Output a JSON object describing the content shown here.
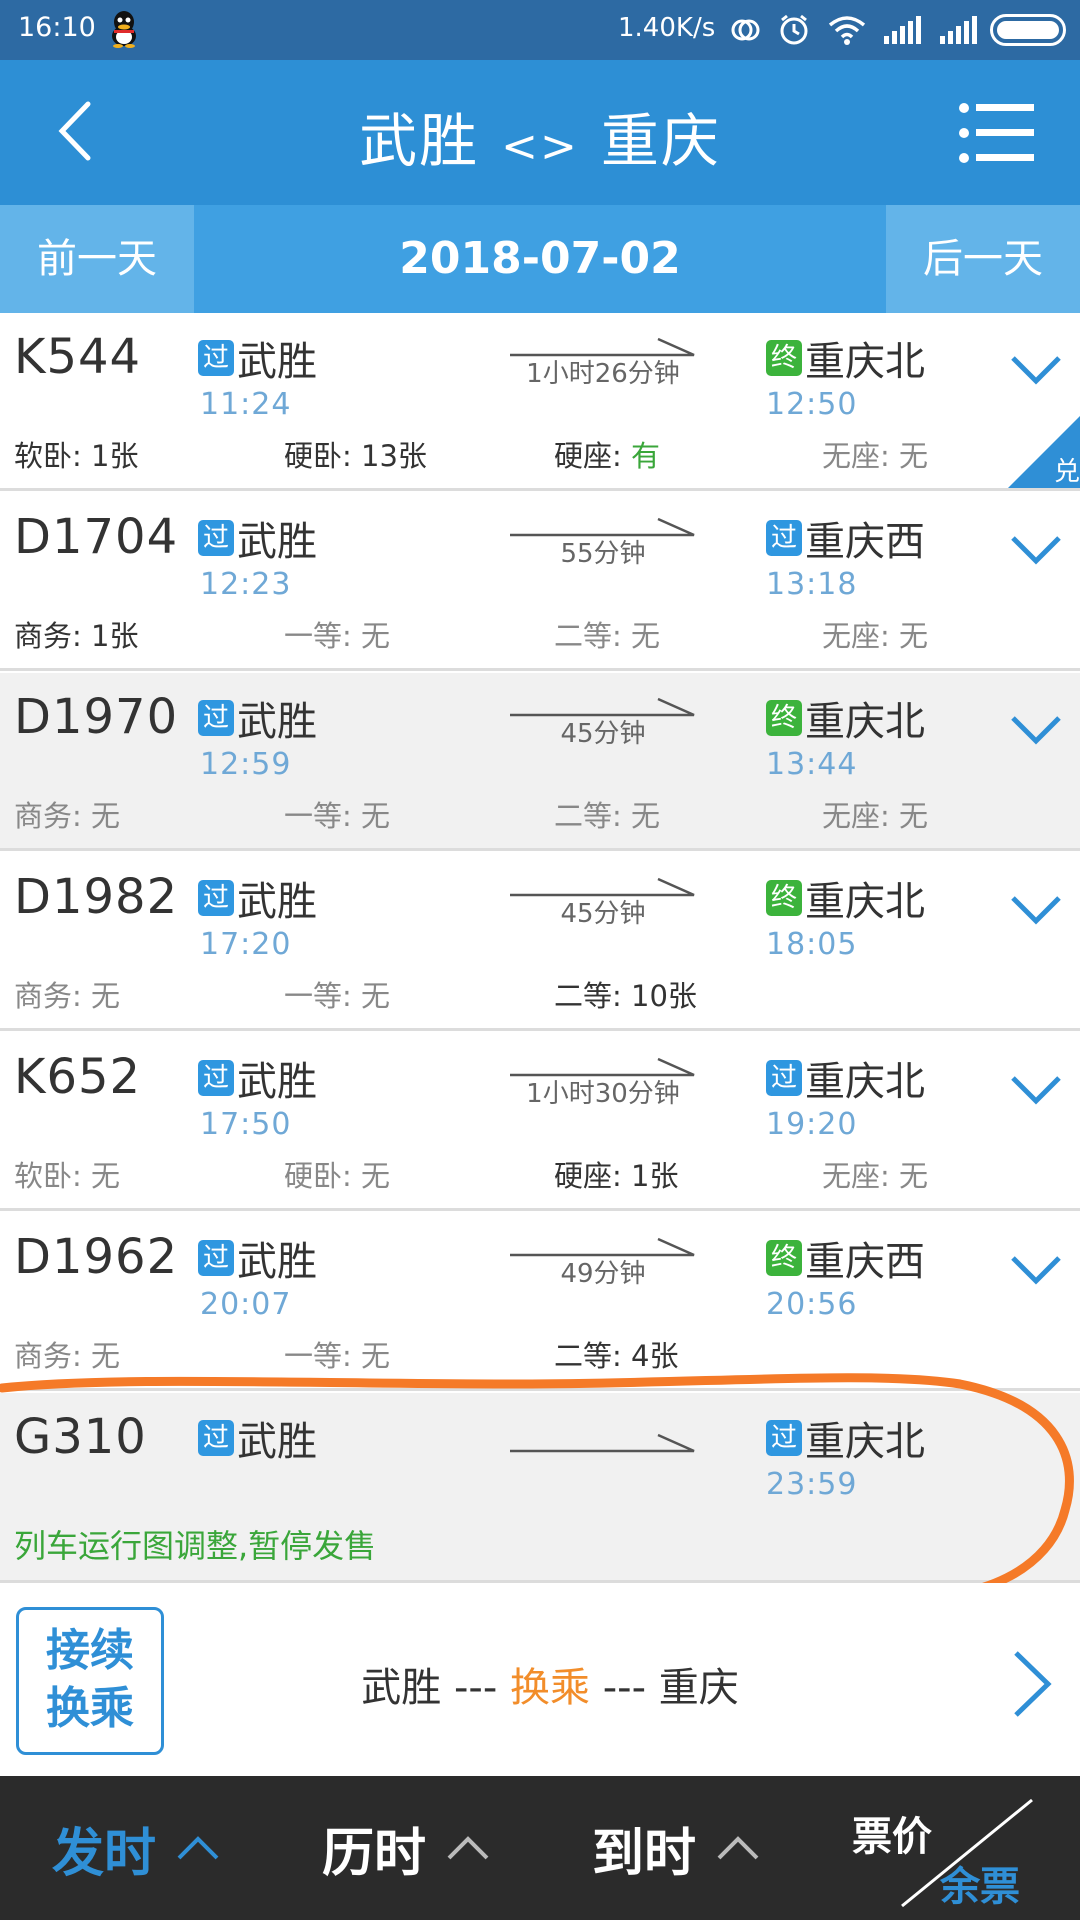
{
  "status_bar": {
    "time": "16:10",
    "net_speed": "1.40K/s",
    "icons": [
      "qq-icon",
      "sync-icon",
      "alarm-icon",
      "wifi-icon",
      "signal-icon",
      "signal-icon",
      "battery-icon"
    ]
  },
  "header": {
    "from": "武胜",
    "separator": "<>",
    "to": "重庆"
  },
  "date_bar": {
    "prev_label": "前一天",
    "date": "2018-07-02",
    "next_label": "后一天"
  },
  "trains": [
    {
      "no": "K544",
      "dep": {
        "badge": "过",
        "station": "武胜",
        "time": "11:24"
      },
      "arr": {
        "badge": "终",
        "station": "重庆北",
        "time": "12:50"
      },
      "duration": "1小时26分钟",
      "seats": [
        {
          "label": "软卧: ",
          "value": "1张"
        },
        {
          "label": "硬卧: ",
          "value": "13张"
        },
        {
          "label": "硬座: ",
          "value": "有"
        },
        {
          "label": "无座: ",
          "value": "无"
        }
      ],
      "corner_badge": "兑"
    },
    {
      "no": "D1704",
      "dep": {
        "badge": "过",
        "station": "武胜",
        "time": "12:23"
      },
      "arr": {
        "badge": "过",
        "station": "重庆西",
        "time": "13:18"
      },
      "duration": "55分钟",
      "seats": [
        {
          "label": "商务: ",
          "value": "1张"
        },
        {
          "label": "一等: ",
          "value": "无"
        },
        {
          "label": "二等: ",
          "value": "无"
        },
        {
          "label": "无座: ",
          "value": "无"
        }
      ]
    },
    {
      "no": "D1970",
      "dep": {
        "badge": "过",
        "station": "武胜",
        "time": "12:59"
      },
      "arr": {
        "badge": "终",
        "station": "重庆北",
        "time": "13:44"
      },
      "duration": "45分钟",
      "seats": [
        {
          "label": "商务: ",
          "value": "无"
        },
        {
          "label": "一等: ",
          "value": "无"
        },
        {
          "label": "二等: ",
          "value": "无"
        },
        {
          "label": "无座: ",
          "value": "无"
        }
      ]
    },
    {
      "no": "D1982",
      "dep": {
        "badge": "过",
        "station": "武胜",
        "time": "17:20"
      },
      "arr": {
        "badge": "终",
        "station": "重庆北",
        "time": "18:05"
      },
      "duration": "45分钟",
      "seats": [
        {
          "label": "商务: ",
          "value": "无"
        },
        {
          "label": "一等: ",
          "value": "无"
        },
        {
          "label": "二等: ",
          "value": "10张"
        }
      ]
    },
    {
      "no": "K652",
      "dep": {
        "badge": "过",
        "station": "武胜",
        "time": "17:50"
      },
      "arr": {
        "badge": "过",
        "station": "重庆北",
        "time": "19:20"
      },
      "duration": "1小时30分钟",
      "seats": [
        {
          "label": "软卧: ",
          "value": "无"
        },
        {
          "label": "硬卧: ",
          "value": "无"
        },
        {
          "label": "硬座: ",
          "value": "1张"
        },
        {
          "label": "无座: ",
          "value": "无"
        }
      ]
    },
    {
      "no": "D1962",
      "dep": {
        "badge": "过",
        "station": "武胜",
        "time": "20:07"
      },
      "arr": {
        "badge": "终",
        "station": "重庆西",
        "time": "20:56"
      },
      "duration": "49分钟",
      "seats": [
        {
          "label": "商务: ",
          "value": "无"
        },
        {
          "label": "一等: ",
          "value": "无"
        },
        {
          "label": "二等: ",
          "value": "4张"
        }
      ]
    },
    {
      "no": "G310",
      "dep": {
        "badge": "过",
        "station": "武胜",
        "time": ""
      },
      "arr": {
        "badge": "过",
        "station": "重庆北",
        "time": "23:59"
      },
      "duration": "",
      "notice": "列车运行图调整,暂停发售"
    }
  ],
  "transfer": {
    "button_line1": "接续",
    "button_line2": "换乘",
    "from": "武胜",
    "dash1": " --- ",
    "middle": "换乘",
    "dash2": " --- ",
    "to": "重庆"
  },
  "sort_bar": {
    "depart": "发时",
    "duration": "历时",
    "arrive": "到时",
    "price": "票价",
    "tickets": "余票"
  },
  "colors": {
    "header_blue": "#2d8fd5",
    "accent_blue": "#2f8fd6",
    "green": "#3aa63a",
    "orange": "#f28d2a",
    "annotation": "#f57a28"
  }
}
